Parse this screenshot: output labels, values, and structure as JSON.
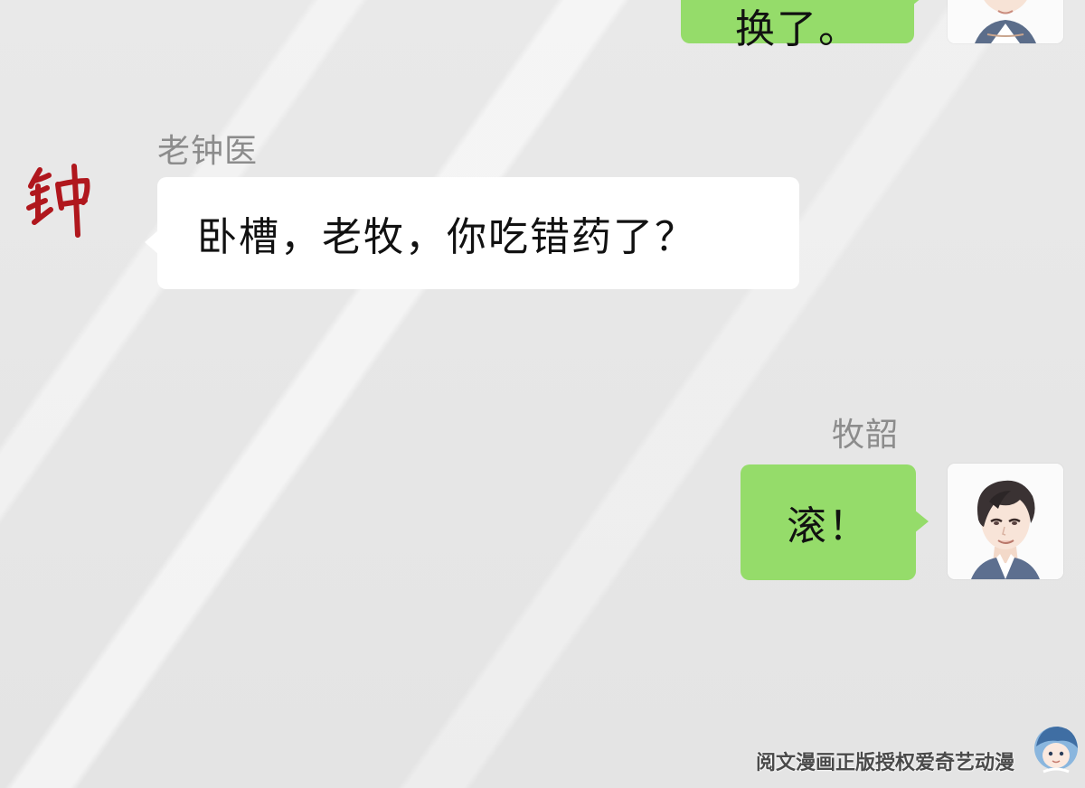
{
  "chat": {
    "prev_message": {
      "text": "换了。",
      "side": "right"
    },
    "message_1": {
      "sender": "老钟医",
      "avatar_glyph": "钟",
      "text": "卧槽，老牧，你吃错药了？",
      "side": "left"
    },
    "message_2": {
      "sender": "牧韶",
      "text": "滚！",
      "side": "right"
    }
  },
  "watermark": {
    "text": "阅文漫画正版授权爱奇艺动漫"
  },
  "colors": {
    "green_bubble": "#95dc6a",
    "white_bubble": "#ffffff",
    "signature_red": "#b0171d"
  },
  "icons": [
    "handwritten-signature-avatar",
    "anime-boy-avatar"
  ]
}
